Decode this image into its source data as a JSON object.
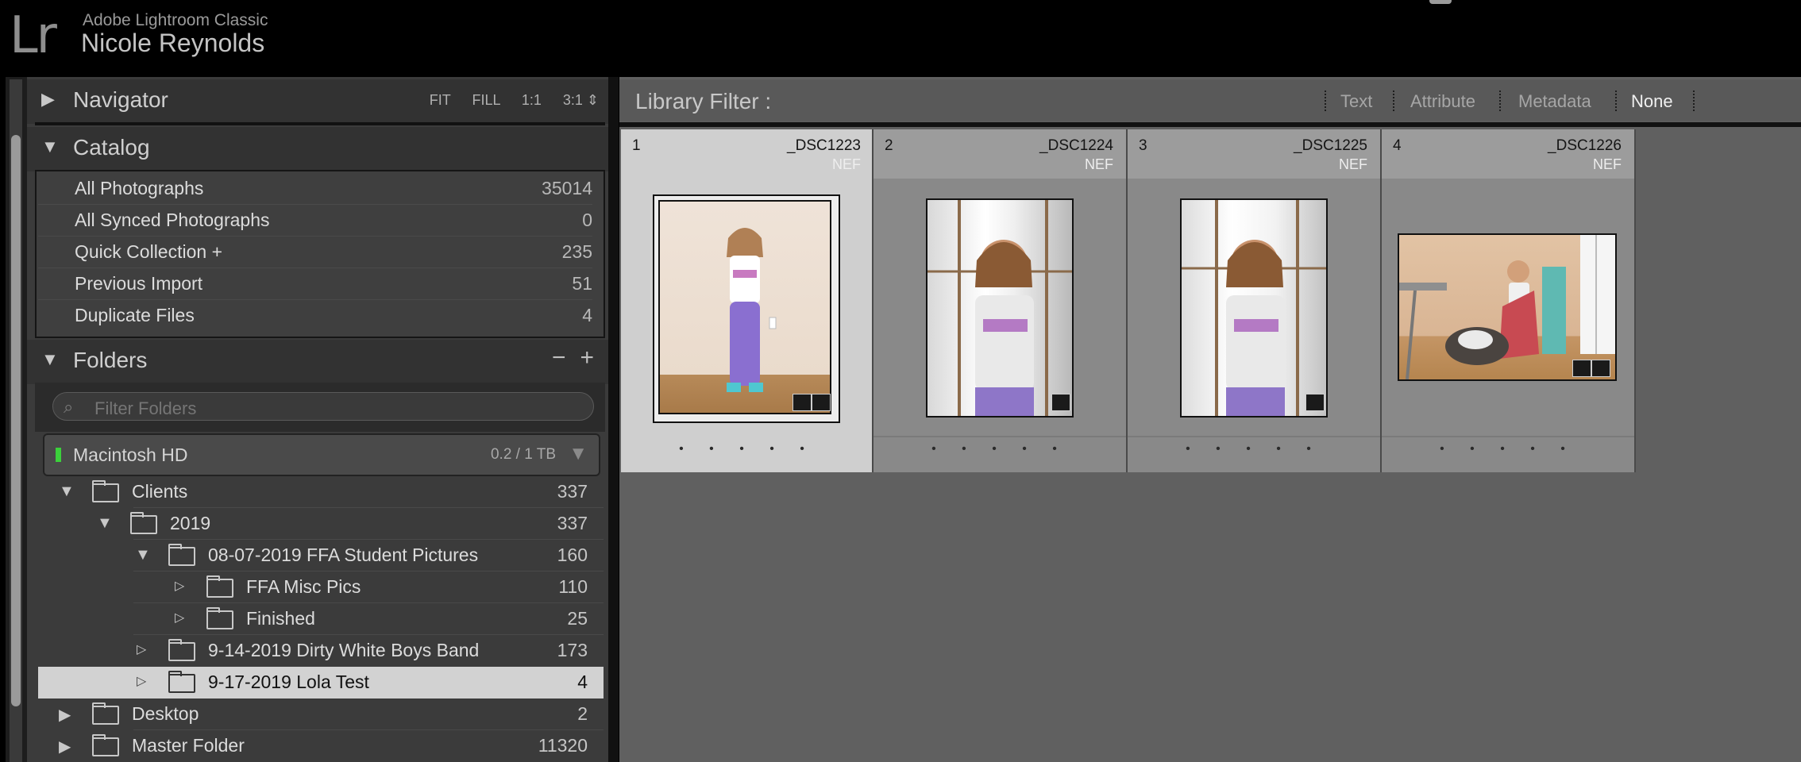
{
  "app": {
    "logo": "Lr",
    "name": "Adobe Lightroom Classic",
    "user": "Nicole Reynolds"
  },
  "navigator": {
    "title": "Navigator",
    "options": [
      "FIT",
      "FILL",
      "1:1",
      "3:1 ⇕"
    ]
  },
  "catalog": {
    "title": "Catalog",
    "items": [
      {
        "label": "All Photographs",
        "count": "35014"
      },
      {
        "label": "All Synced Photographs",
        "count": "0"
      },
      {
        "label": "Quick Collection  +",
        "count": "235"
      },
      {
        "label": "Previous Import",
        "count": "51"
      },
      {
        "label": "Duplicate Files",
        "count": "4"
      }
    ]
  },
  "folders": {
    "title": "Folders",
    "minus": "−",
    "plus": "+",
    "filter_placeholder": "Filter Folders",
    "volume": {
      "name": "Macintosh HD",
      "size": "0.2 / 1 TB"
    },
    "items": [
      {
        "name": "Clients",
        "count": "337"
      },
      {
        "name": "2019",
        "count": "337"
      },
      {
        "name": "08-07-2019 FFA Student Pictures",
        "count": "160"
      },
      {
        "name": "FFA Misc Pics",
        "count": "110"
      },
      {
        "name": "Finished",
        "count": "25"
      },
      {
        "name": "9-14-2019 Dirty White Boys Band",
        "count": "173"
      },
      {
        "name": "9-17-2019 Lola Test",
        "count": "4"
      },
      {
        "name": "Desktop",
        "count": "2"
      },
      {
        "name": "Master Folder",
        "count": "11320"
      }
    ]
  },
  "library_filter": {
    "title": "Library Filter :",
    "tabs": [
      "Text",
      "Attribute",
      "Metadata",
      "None"
    ],
    "active": "None"
  },
  "grid": {
    "cells": [
      {
        "index": "1",
        "filename": "_DSC1223",
        "ext": "NEF",
        "stars": "• • • • •"
      },
      {
        "index": "2",
        "filename": "_DSC1224",
        "ext": "NEF",
        "stars": "• • • • •"
      },
      {
        "index": "3",
        "filename": "_DSC1225",
        "ext": "NEF",
        "stars": "• • • • •"
      },
      {
        "index": "4",
        "filename": "_DSC1226",
        "ext": "NEF",
        "stars": "• • • • •"
      }
    ]
  },
  "colors": {
    "accent_selected": "#d2d2d2",
    "volume_led": "#3bd13b",
    "grid_bg": "#606060"
  }
}
